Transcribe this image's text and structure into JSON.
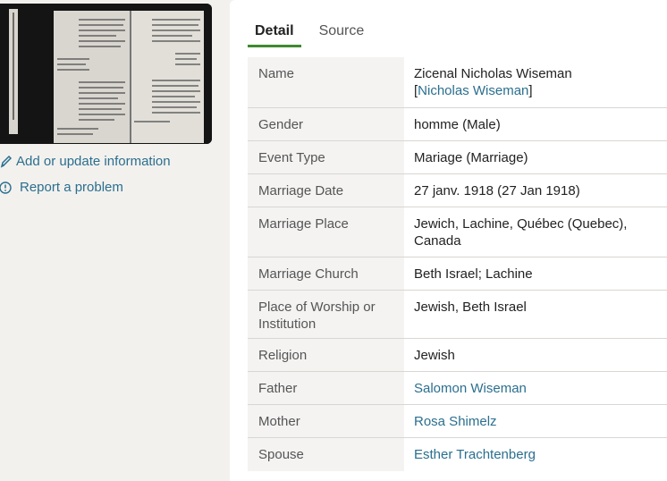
{
  "actions": {
    "add_update": "Add or update information",
    "report": "Report a problem"
  },
  "tabs": [
    {
      "label": "Detail",
      "active": true
    },
    {
      "label": "Source",
      "active": false
    }
  ],
  "details": {
    "name": {
      "label": "Name",
      "value": "Zicenal Nicholas Wiseman",
      "alt_open": "[",
      "alt": "Nicholas Wiseman",
      "alt_close": "]"
    },
    "gender": {
      "label": "Gender",
      "value": "homme (Male)"
    },
    "event_type": {
      "label": "Event Type",
      "value": "Mariage (Marriage)"
    },
    "marriage_date": {
      "label": "Marriage Date",
      "value": "27 janv. 1918 (27 Jan 1918)"
    },
    "marriage_place": {
      "label": "Marriage Place",
      "value": "Jewich, Lachine, Québec (Quebec), Canada"
    },
    "marriage_church": {
      "label": "Marriage Church",
      "value": "Beth Israel; Lachine"
    },
    "place_of_worship": {
      "label": "Place of Worship or Institution",
      "value": "Jewish, Beth Israel"
    },
    "religion": {
      "label": "Religion",
      "value": "Jewish"
    },
    "father": {
      "label": "Father",
      "value": "Salomon Wiseman"
    },
    "mother": {
      "label": "Mother",
      "value": "Rosa Shimelz"
    },
    "spouse": {
      "label": "Spouse",
      "value": "Esther Trachtenberg"
    }
  },
  "colors": {
    "accent_link": "#2a6f8f",
    "tab_underline": "#3e8a2f"
  }
}
